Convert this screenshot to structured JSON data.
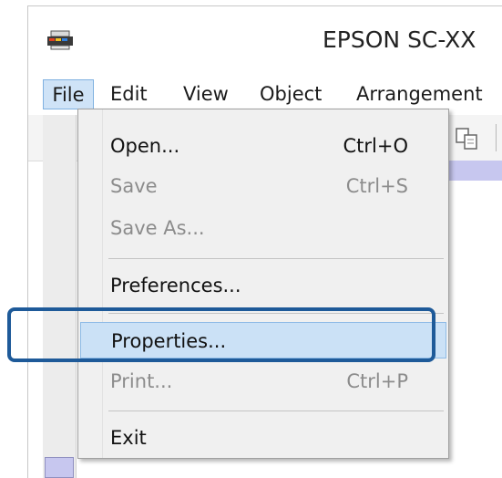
{
  "window": {
    "title": "EPSON SC-XX"
  },
  "icons": {
    "app": "printer-app-icon",
    "toolbar": "copy-icon"
  },
  "menubar": {
    "items": [
      {
        "label": "File",
        "active": true
      },
      {
        "label": "Edit"
      },
      {
        "label": "View"
      },
      {
        "label": "Object"
      },
      {
        "label": "Arrangement"
      }
    ]
  },
  "file_menu": {
    "items": [
      {
        "label": "Open...",
        "shortcut": "Ctrl+O",
        "enabled": true
      },
      {
        "label": "Save",
        "shortcut": "Ctrl+S",
        "enabled": false
      },
      {
        "label": "Save As...",
        "shortcut": "",
        "enabled": false
      },
      {
        "label": "Preferences...",
        "shortcut": "",
        "enabled": true
      },
      {
        "label": "Properties...",
        "shortcut": "",
        "enabled": true,
        "highlighted": true
      },
      {
        "label": "Print...",
        "shortcut": "Ctrl+P",
        "enabled": false
      },
      {
        "label": "Exit",
        "shortcut": "",
        "enabled": true
      }
    ]
  },
  "colors": {
    "highlight": "#cbe1f6",
    "callout_border": "#1e5a99",
    "canvas_accent": "#c7c7ef"
  }
}
